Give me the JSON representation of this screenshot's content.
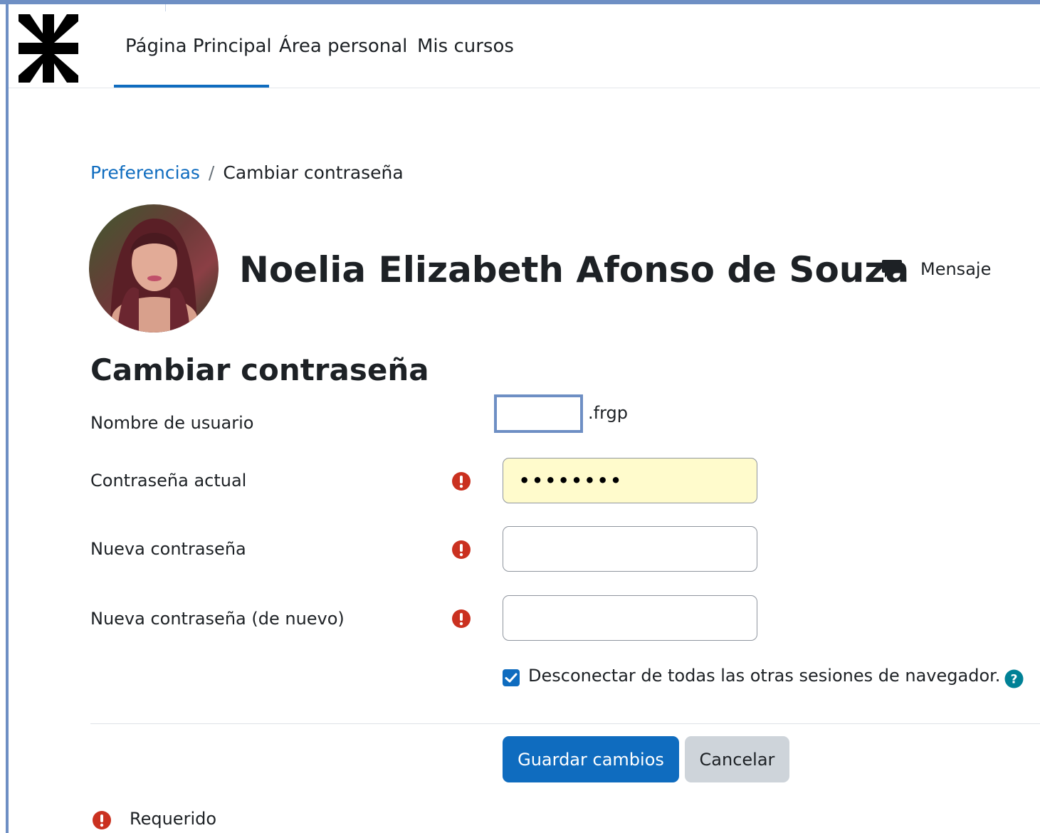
{
  "nav": {
    "items": [
      {
        "label": "Página Principal",
        "active": true
      },
      {
        "label": "Área personal",
        "active": false
      },
      {
        "label": "Mis cursos",
        "active": false
      }
    ]
  },
  "breadcrumb": {
    "parent": "Preferencias",
    "separator": "/",
    "current": "Cambiar contraseña"
  },
  "profile": {
    "name": "Noelia Elizabeth Afonso de Souza",
    "message_label": "Mensaje"
  },
  "form": {
    "title": "Cambiar contraseña",
    "username_label": "Nombre de usuario",
    "username_value": ".frgp",
    "current_password_label": "Contraseña actual",
    "current_password_value": "••••••••",
    "new_password_label": "Nueva contraseña",
    "new_password_value": "",
    "new_password_again_label": "Nueva contraseña (de nuevo)",
    "new_password_again_value": "",
    "logout_sessions_label": "Desconectar de todas las otras sesiones de navegador.",
    "logout_sessions_checked": true,
    "save_label": "Guardar cambios",
    "cancel_label": "Cancelar",
    "required_legend": "Requerido"
  },
  "icons": {
    "required": "exclamation-circle-icon",
    "help": "question-circle-icon",
    "message": "speech-bubble-icon",
    "logo": "utn-logo-icon"
  },
  "colors": {
    "primary": "#0f6cbf",
    "required_red": "#ca3120",
    "help_teal": "#008196",
    "autofill_bg": "#fffbcc",
    "secondary_btn": "#ced4da"
  }
}
